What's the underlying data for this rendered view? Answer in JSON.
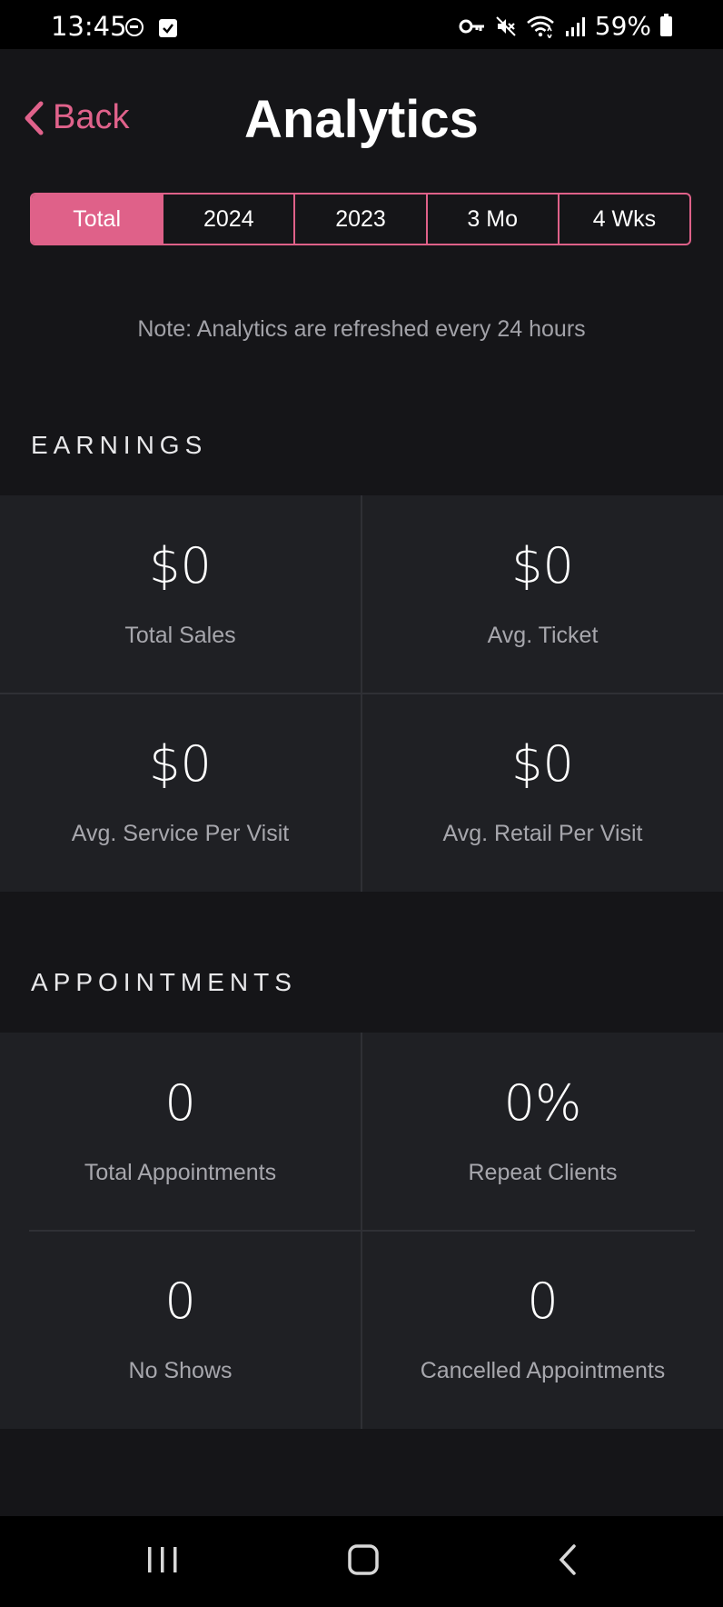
{
  "status_bar": {
    "time": "13:45",
    "battery": "59%",
    "icons": [
      "dnd-icon",
      "checkbox-icon",
      "vpn-key-icon",
      "mute-icon",
      "wifi-icon",
      "signal-icon",
      "battery-icon"
    ]
  },
  "header": {
    "back_label": "Back",
    "title": "Analytics"
  },
  "periods": {
    "items": [
      "Total",
      "2024",
      "2023",
      "3 Mo",
      "4 Wks"
    ],
    "selected": "Total"
  },
  "note": "Note: Analytics are refreshed every 24 hours",
  "earnings": {
    "title": "EARNINGS",
    "cells": [
      {
        "value": "$0",
        "label": "Total Sales"
      },
      {
        "value": "$0",
        "label": "Avg. Ticket"
      },
      {
        "value": "$0",
        "label": "Avg. Service Per Visit"
      },
      {
        "value": "$0",
        "label": "Avg. Retail Per Visit"
      }
    ]
  },
  "appointments": {
    "title": "APPOINTMENTS",
    "cells": [
      {
        "value": "0",
        "label": "Total Appointments"
      },
      {
        "value": "0%",
        "label": "Repeat Clients"
      },
      {
        "value": "0",
        "label": "No Shows"
      },
      {
        "value": "0",
        "label": "Cancelled Appointments"
      }
    ]
  },
  "colors": {
    "accent": "#df6189",
    "background": "#151518",
    "card": "#1f2024"
  },
  "nav_icons": [
    "recent-apps-icon",
    "home-icon",
    "back-nav-icon"
  ]
}
